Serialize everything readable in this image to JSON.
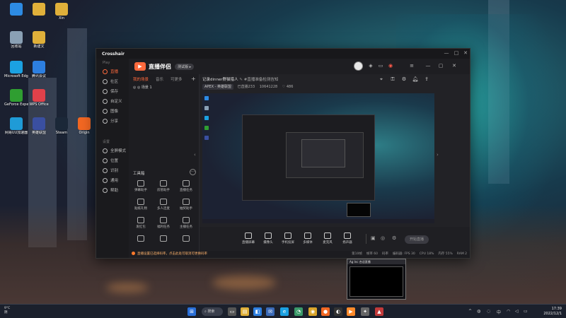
{
  "desktop": {
    "icons": [
      {
        "label": "",
        "color": "#2d8be3"
      },
      {
        "label": "",
        "color": "#e0b03a"
      },
      {
        "label": "Xin",
        "color": "#e0b03a"
      },
      {
        "label": "回收站",
        "color": "#8aa0b4"
      },
      {
        "label": "新建文",
        "color": "#e0b03a"
      },
      {
        "label": "Microsoft Edge",
        "color": "#1ba1e2"
      },
      {
        "label": "腾讯会议",
        "color": "#2d7fe0"
      },
      {
        "label": "GeForce Experience",
        "color": "#2f9e31"
      },
      {
        "label": "WPS Office",
        "color": "#e0414a"
      },
      {
        "label": "网易UU加速器",
        "color": "#1f9bd7"
      },
      {
        "label": "英雄联盟",
        "color": "#3a4fa0"
      },
      {
        "label": "Steam",
        "color": "#1b2838"
      },
      {
        "label": "Origin",
        "color": "#f26722"
      }
    ]
  },
  "app": {
    "title": "Crosshair",
    "window_controls": [
      "—",
      "□",
      "✕"
    ],
    "sidebar": {
      "section1": "Play",
      "items": [
        {
          "label": "直播",
          "active": true
        },
        {
          "label": "社区",
          "active": false
        },
        {
          "label": "保存",
          "active": false
        },
        {
          "label": "自定义",
          "active": false
        },
        {
          "label": "图像",
          "active": false
        },
        {
          "label": "分享",
          "active": false
        }
      ],
      "section2": "设置",
      "items2": [
        {
          "label": "全屏模式"
        },
        {
          "label": "位置"
        },
        {
          "label": "识别"
        },
        {
          "label": "通用"
        },
        {
          "label": "帮助"
        }
      ]
    }
  },
  "live": {
    "logo_text": "直播伴侣",
    "version_badge": "测试版 ▸",
    "scene_tabs": [
      "我的场景",
      "音乐",
      "可更多"
    ],
    "scene_add": "+",
    "scene_item": "◎ ◎ 场景 1",
    "tools_title": "工具箱",
    "tools_more": "···",
    "tools": [
      "弹幕助手",
      "房管助手",
      "直播任务",
      "贴纸礼物",
      "多人连麦",
      "抽奖助手",
      "发红包",
      "福利任务",
      "主播任务",
      "",
      "",
      ""
    ],
    "stream_title": "记录dinner野猫猎人",
    "stream_badge": "#直播准备检测告知",
    "category": "APEX - 英雄联盟",
    "meta1": "已直播233",
    "meta2": "10641228",
    "meta3": "486",
    "controls": [
      {
        "label": "直播屏幕"
      },
      {
        "label": "摄像头"
      },
      {
        "label": "手机投屏"
      },
      {
        "label": "多媒体"
      },
      {
        "label": "麦克风"
      },
      {
        "label": "扬声器"
      }
    ],
    "start_button": "开始直播",
    "status_strip": [
      "第10帧",
      "帧率 60",
      "码率",
      "编码器: FPS 30",
      "CPU 18%",
      "内存 55%",
      "RAM 2"
    ],
    "warning": "直播设置已选择码率，点击此处可取消可更换码率"
  },
  "float_preview": {
    "title": "Ag Inc 合适直播"
  },
  "taskbar": {
    "weather_temp": "9°C",
    "weather_desc": "阴",
    "search_label": "搜索",
    "time": "17:39",
    "date": "2022/12/1"
  }
}
